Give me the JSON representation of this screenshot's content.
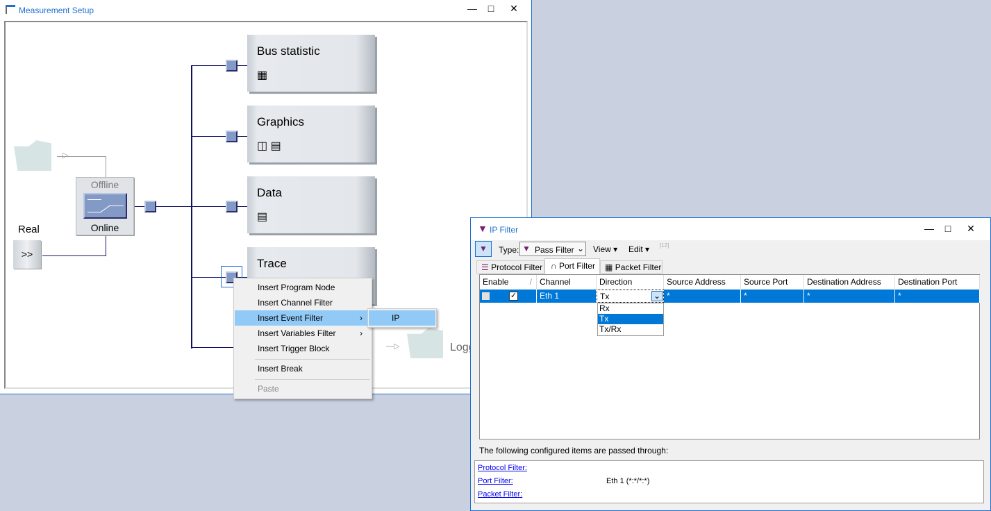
{
  "measurement_setup": {
    "title": "Measurement Setup",
    "blocks": [
      {
        "label": "Bus statistic"
      },
      {
        "label": "Graphics"
      },
      {
        "label": "Data"
      },
      {
        "label": "Trace"
      }
    ],
    "switch": {
      "offline": "Offline",
      "online": "Online"
    },
    "real_label": "Real",
    "real_button": ">>",
    "logging_label": "Logg"
  },
  "context_menu": {
    "items": [
      "Insert Program Node",
      "Insert Channel Filter",
      "Insert Event Filter",
      "Insert Variables Filter",
      "Insert Trigger Block",
      "Insert Break",
      "Paste"
    ],
    "submenu": [
      "IP"
    ]
  },
  "ip_filter": {
    "title": "IP Filter",
    "toolbar": {
      "type_label": "Type:",
      "type_value": "Pass Filter",
      "view": "View",
      "edit": "Edit"
    },
    "tabs": [
      "Protocol Filter",
      "Port Filter",
      "Packet Filter"
    ],
    "active_tab": "Port Filter",
    "columns": [
      "Enable",
      "Channel",
      "Direction",
      "Source Address",
      "Source Port",
      "Destination Address",
      "Destination Port"
    ],
    "rows": [
      {
        "enabled": true,
        "channel": "Eth 1",
        "direction": "Tx",
        "source_address": "*",
        "source_port": "*",
        "destination_address": "*",
        "destination_port": "*"
      }
    ],
    "direction_options": [
      "Rx",
      "Tx",
      "Tx/Rx"
    ],
    "direction_selected": "Tx",
    "status_text": "The following configured items are passed through:",
    "summary": [
      {
        "label": "Protocol Filter:",
        "value": ""
      },
      {
        "label": "Port Filter:",
        "value": "Eth 1 (*:*/*:*)"
      },
      {
        "label": "Packet Filter:",
        "value": ""
      }
    ]
  },
  "colors": {
    "selection": "#0078d7",
    "menu_highlight": "#91c9f7",
    "title": "#1e6fd0"
  }
}
